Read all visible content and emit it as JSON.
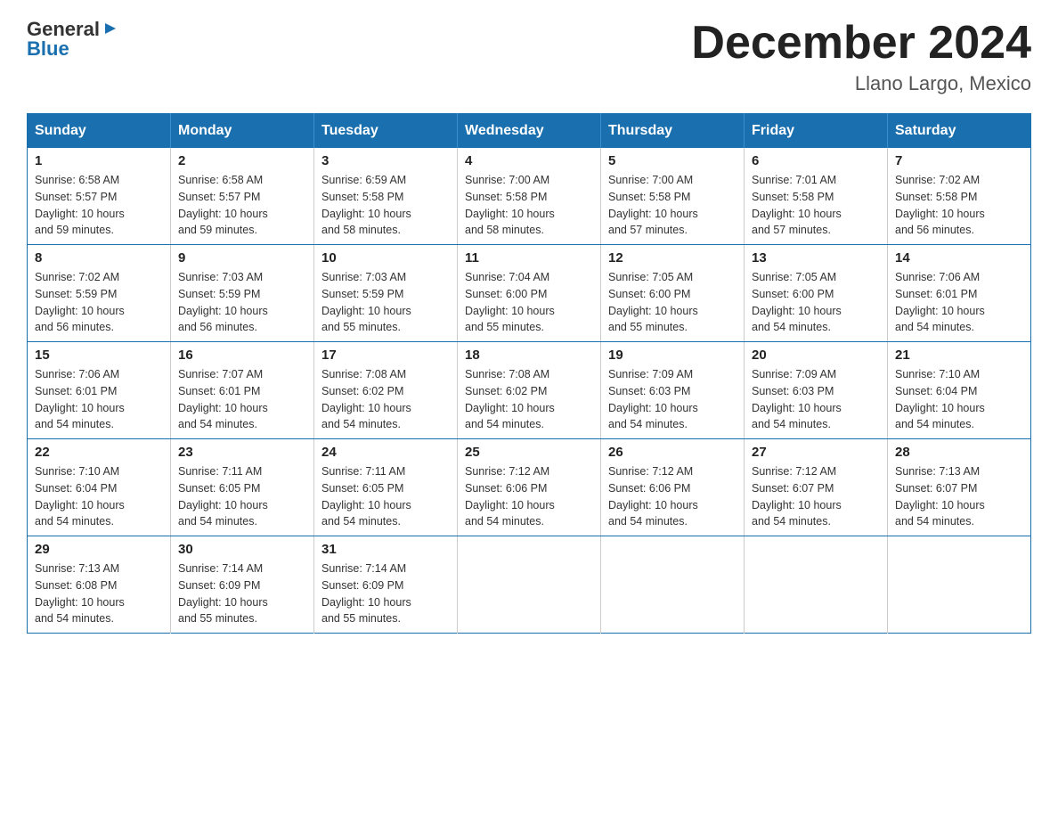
{
  "header": {
    "logo": {
      "general": "General",
      "blue": "Blue",
      "arrow": "▶"
    },
    "title": "December 2024",
    "location": "Llano Largo, Mexico"
  },
  "days_of_week": [
    "Sunday",
    "Monday",
    "Tuesday",
    "Wednesday",
    "Thursday",
    "Friday",
    "Saturday"
  ],
  "weeks": [
    [
      {
        "day": "1",
        "sunrise": "6:58 AM",
        "sunset": "5:57 PM",
        "daylight": "10 hours and 59 minutes."
      },
      {
        "day": "2",
        "sunrise": "6:58 AM",
        "sunset": "5:57 PM",
        "daylight": "10 hours and 59 minutes."
      },
      {
        "day": "3",
        "sunrise": "6:59 AM",
        "sunset": "5:58 PM",
        "daylight": "10 hours and 58 minutes."
      },
      {
        "day": "4",
        "sunrise": "7:00 AM",
        "sunset": "5:58 PM",
        "daylight": "10 hours and 58 minutes."
      },
      {
        "day": "5",
        "sunrise": "7:00 AM",
        "sunset": "5:58 PM",
        "daylight": "10 hours and 57 minutes."
      },
      {
        "day": "6",
        "sunrise": "7:01 AM",
        "sunset": "5:58 PM",
        "daylight": "10 hours and 57 minutes."
      },
      {
        "day": "7",
        "sunrise": "7:02 AM",
        "sunset": "5:58 PM",
        "daylight": "10 hours and 56 minutes."
      }
    ],
    [
      {
        "day": "8",
        "sunrise": "7:02 AM",
        "sunset": "5:59 PM",
        "daylight": "10 hours and 56 minutes."
      },
      {
        "day": "9",
        "sunrise": "7:03 AM",
        "sunset": "5:59 PM",
        "daylight": "10 hours and 56 minutes."
      },
      {
        "day": "10",
        "sunrise": "7:03 AM",
        "sunset": "5:59 PM",
        "daylight": "10 hours and 55 minutes."
      },
      {
        "day": "11",
        "sunrise": "7:04 AM",
        "sunset": "6:00 PM",
        "daylight": "10 hours and 55 minutes."
      },
      {
        "day": "12",
        "sunrise": "7:05 AM",
        "sunset": "6:00 PM",
        "daylight": "10 hours and 55 minutes."
      },
      {
        "day": "13",
        "sunrise": "7:05 AM",
        "sunset": "6:00 PM",
        "daylight": "10 hours and 54 minutes."
      },
      {
        "day": "14",
        "sunrise": "7:06 AM",
        "sunset": "6:01 PM",
        "daylight": "10 hours and 54 minutes."
      }
    ],
    [
      {
        "day": "15",
        "sunrise": "7:06 AM",
        "sunset": "6:01 PM",
        "daylight": "10 hours and 54 minutes."
      },
      {
        "day": "16",
        "sunrise": "7:07 AM",
        "sunset": "6:01 PM",
        "daylight": "10 hours and 54 minutes."
      },
      {
        "day": "17",
        "sunrise": "7:08 AM",
        "sunset": "6:02 PM",
        "daylight": "10 hours and 54 minutes."
      },
      {
        "day": "18",
        "sunrise": "7:08 AM",
        "sunset": "6:02 PM",
        "daylight": "10 hours and 54 minutes."
      },
      {
        "day": "19",
        "sunrise": "7:09 AM",
        "sunset": "6:03 PM",
        "daylight": "10 hours and 54 minutes."
      },
      {
        "day": "20",
        "sunrise": "7:09 AM",
        "sunset": "6:03 PM",
        "daylight": "10 hours and 54 minutes."
      },
      {
        "day": "21",
        "sunrise": "7:10 AM",
        "sunset": "6:04 PM",
        "daylight": "10 hours and 54 minutes."
      }
    ],
    [
      {
        "day": "22",
        "sunrise": "7:10 AM",
        "sunset": "6:04 PM",
        "daylight": "10 hours and 54 minutes."
      },
      {
        "day": "23",
        "sunrise": "7:11 AM",
        "sunset": "6:05 PM",
        "daylight": "10 hours and 54 minutes."
      },
      {
        "day": "24",
        "sunrise": "7:11 AM",
        "sunset": "6:05 PM",
        "daylight": "10 hours and 54 minutes."
      },
      {
        "day": "25",
        "sunrise": "7:12 AM",
        "sunset": "6:06 PM",
        "daylight": "10 hours and 54 minutes."
      },
      {
        "day": "26",
        "sunrise": "7:12 AM",
        "sunset": "6:06 PM",
        "daylight": "10 hours and 54 minutes."
      },
      {
        "day": "27",
        "sunrise": "7:12 AM",
        "sunset": "6:07 PM",
        "daylight": "10 hours and 54 minutes."
      },
      {
        "day": "28",
        "sunrise": "7:13 AM",
        "sunset": "6:07 PM",
        "daylight": "10 hours and 54 minutes."
      }
    ],
    [
      {
        "day": "29",
        "sunrise": "7:13 AM",
        "sunset": "6:08 PM",
        "daylight": "10 hours and 54 minutes."
      },
      {
        "day": "30",
        "sunrise": "7:14 AM",
        "sunset": "6:09 PM",
        "daylight": "10 hours and 55 minutes."
      },
      {
        "day": "31",
        "sunrise": "7:14 AM",
        "sunset": "6:09 PM",
        "daylight": "10 hours and 55 minutes."
      },
      null,
      null,
      null,
      null
    ]
  ],
  "labels": {
    "sunrise": "Sunrise:",
    "sunset": "Sunset:",
    "daylight": "Daylight:"
  }
}
